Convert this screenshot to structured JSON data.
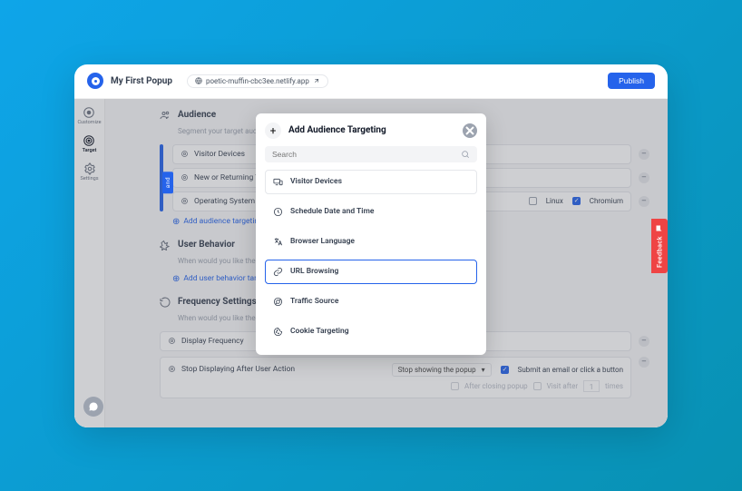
{
  "header": {
    "title": "My First Popup",
    "url": "poetic-muffin-cbc3ee.netlify.app",
    "publish_label": "Publish"
  },
  "sidebar": {
    "items": [
      {
        "label": "Customize",
        "icon": "palette"
      },
      {
        "label": "Target",
        "icon": "target"
      },
      {
        "label": "Settings",
        "icon": "settings"
      }
    ]
  },
  "audience": {
    "title": "Audience",
    "subtitle": "Segment your target audience",
    "rules": [
      {
        "label": "Visitor Devices"
      },
      {
        "label": "New or Returning Visitor"
      },
      {
        "label": "Operating System",
        "trailing": [
          {
            "label": "Linux",
            "checked": false
          },
          {
            "label": "Chromium",
            "checked": true
          }
        ]
      }
    ],
    "and_label": "and",
    "add_label": "Add audience targeting"
  },
  "behavior": {
    "title": "User Behavior",
    "subtitle": "When would you like the popup to…",
    "add_label": "Add user behavior targeting"
  },
  "frequency": {
    "title": "Frequency Settings",
    "subtitle": "When would you like the popup to…",
    "rules": [
      {
        "label": "Display Frequency"
      },
      {
        "label": "Stop Displaying After User Action",
        "select": "Stop showing the popup",
        "line1": {
          "checked": true,
          "text": "Submit an email or click a button"
        },
        "line2": {
          "checked": false,
          "text1": "After closing popup",
          "text2": "Visit after",
          "value": "1",
          "text3": "times"
        }
      }
    ]
  },
  "modal": {
    "title": "Add Audience Targeting",
    "search_placeholder": "Search",
    "options": [
      {
        "label": "Visitor Devices",
        "icon": "devices"
      },
      {
        "label": "Schedule Date and Time",
        "icon": "clock"
      },
      {
        "label": "Browser Language",
        "icon": "language"
      },
      {
        "label": "URL Browsing",
        "icon": "link",
        "selected": true
      },
      {
        "label": "Traffic Source",
        "icon": "source"
      },
      {
        "label": "Cookie Targeting",
        "icon": "cookie"
      }
    ]
  },
  "feedback_label": "Feedback"
}
